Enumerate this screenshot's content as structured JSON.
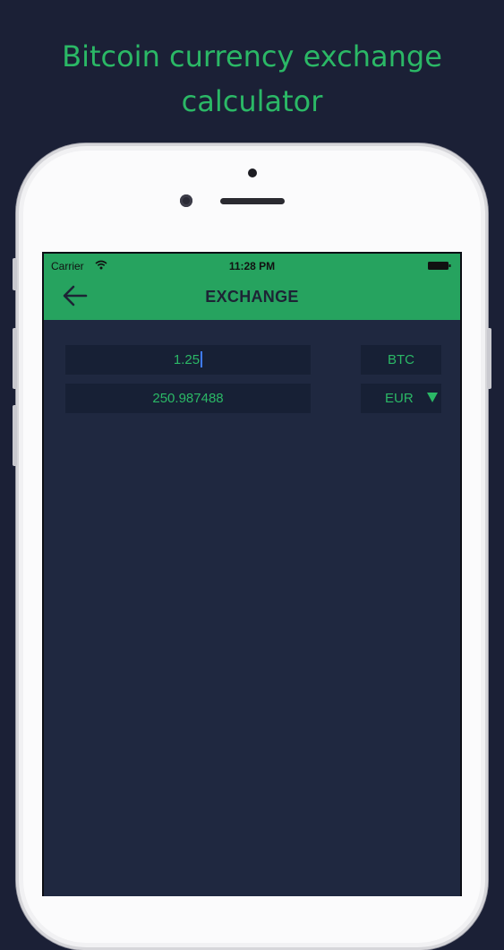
{
  "promo": {
    "title_line1": "Bitcoin currency exchange",
    "title_line2": "calculator"
  },
  "status_bar": {
    "carrier": "Carrier",
    "time": "11:28 PM"
  },
  "header": {
    "title": "EXCHANGE"
  },
  "exchange": {
    "amount_value": "1.25",
    "result_value": "250.987488",
    "from_currency": "BTC",
    "to_currency": "EUR"
  },
  "colors": {
    "background": "#1b2036",
    "accent_green": "#26a35f",
    "text_green": "#2bb866",
    "screen_bg": "#1f2840",
    "field_bg": "#172035"
  },
  "icons": {
    "back": "arrow-left-icon",
    "wifi": "wifi-icon",
    "battery": "battery-icon",
    "dropdown": "triangle-down-icon"
  }
}
